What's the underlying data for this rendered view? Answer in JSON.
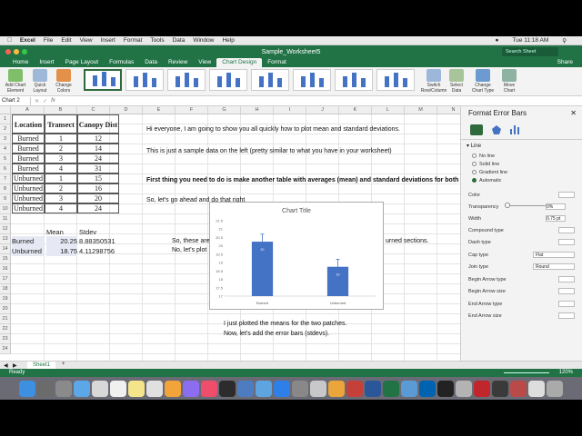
{
  "menubar": {
    "items": [
      "Excel",
      "File",
      "Edit",
      "View",
      "Insert",
      "Format",
      "Tools",
      "Data",
      "Window",
      "Help"
    ],
    "clock": "Tue 11:18 AM"
  },
  "window": {
    "title": "Sample_Worksheet5",
    "search_placeholder": "Search Sheet"
  },
  "ribbon_tabs": [
    "Home",
    "Insert",
    "Page Layout",
    "Formulas",
    "Data",
    "Review",
    "View",
    "Chart Design",
    "Format"
  ],
  "active_tab": "Chart Design",
  "share_label": "Share",
  "ribbon_buttons": {
    "add_chart_element": "Add Chart\nElement",
    "quick_layout": "Quick\nLayout",
    "change_colors": "Change\nColors",
    "switch_row_col": "Switch\nRow/Column",
    "select_data": "Select\nData",
    "change_chart_type": "Change\nChart Type",
    "move_chart": "Move\nChart"
  },
  "formula_bar": {
    "name_box": "Chart 2",
    "fx": "fx",
    "value": ""
  },
  "columns": [
    "A",
    "B",
    "C",
    "D",
    "E",
    "F",
    "G",
    "H",
    "I",
    "J",
    "K",
    "L",
    "M",
    "N"
  ],
  "rows": [
    "1",
    "2",
    "3",
    "4",
    "5",
    "6",
    "7",
    "8",
    "9",
    "10",
    "11",
    "12",
    "13",
    "14",
    "15",
    "16",
    "17",
    "18",
    "19",
    "20",
    "21",
    "22",
    "23",
    "24"
  ],
  "table": {
    "headers": [
      "Location",
      "Transect",
      "Canopy Dist"
    ],
    "rows": [
      [
        "Burned",
        "1",
        "12"
      ],
      [
        "Burned",
        "2",
        "14"
      ],
      [
        "Burned",
        "3",
        "24"
      ],
      [
        "Burned",
        "4",
        "31"
      ],
      [
        "Unburned",
        "1",
        "15"
      ],
      [
        "Unburned",
        "2",
        "16"
      ],
      [
        "Unburned",
        "3",
        "20"
      ],
      [
        "Unburned",
        "4",
        "24"
      ]
    ]
  },
  "summary": {
    "mean_label": "Mean",
    "stdev_label": "Stdev",
    "rows": [
      [
        "Burned",
        "20.25",
        "8.88350531"
      ],
      [
        "Unburned",
        "18.75",
        "4.11298756"
      ]
    ]
  },
  "notes": {
    "n1": "Hi everyone, I am going to show you all quickly how to plot mean and standard deviations.",
    "n2": "This is just a sample data on the left (pretty similar to what you have in your worksheet)",
    "n3": "First thing you need to do is make another table with averages (mean) and standard deviations for both",
    "n4": "So, let's go ahead and do that right",
    "n5": "So, these are",
    "n5b": "urned sections.",
    "n6": "No, let's plot",
    "n7": "I just plotted the means for the two patches.",
    "n8": "Now, let's add the error bars (stdevs)."
  },
  "chart_data": {
    "type": "bar",
    "title": "Chart Title",
    "categories": [
      "Burned",
      "Unburned"
    ],
    "values": [
      20.25,
      18.75
    ],
    "error": [
      0.45,
      0.45
    ],
    "data_labels": [
      "20",
      "19"
    ],
    "ylim": [
      17,
      21.5
    ],
    "yticks": [
      "17",
      "17.5",
      "18",
      "18.5",
      "19",
      "19.5",
      "20",
      "20.5",
      "21",
      "21.5"
    ],
    "bar_color": "#4472c4",
    "xlabel": "",
    "ylabel": ""
  },
  "panel": {
    "title": "Format Error Bars",
    "section": "Line",
    "line_options": [
      "No line",
      "Solid line",
      "Gradient line",
      "Automatic"
    ],
    "selected_line": "Automatic",
    "props": [
      "Color",
      "Transparency",
      "Width",
      "Compound type",
      "Dash type",
      "Cap type",
      "Join type",
      "Begin Arrow type",
      "Begin Arrow size",
      "End Arrow type",
      "End Arrow size"
    ],
    "transparency_value": "0%",
    "width_value": "0.75 pt",
    "cap_value": "Flat",
    "join_value": "Round"
  },
  "sheet_tab": "Sheet1",
  "status": {
    "ready": "Ready",
    "zoom": "120%"
  },
  "colors": {
    "excel_green": "#217346",
    "bar": "#4472c4"
  }
}
